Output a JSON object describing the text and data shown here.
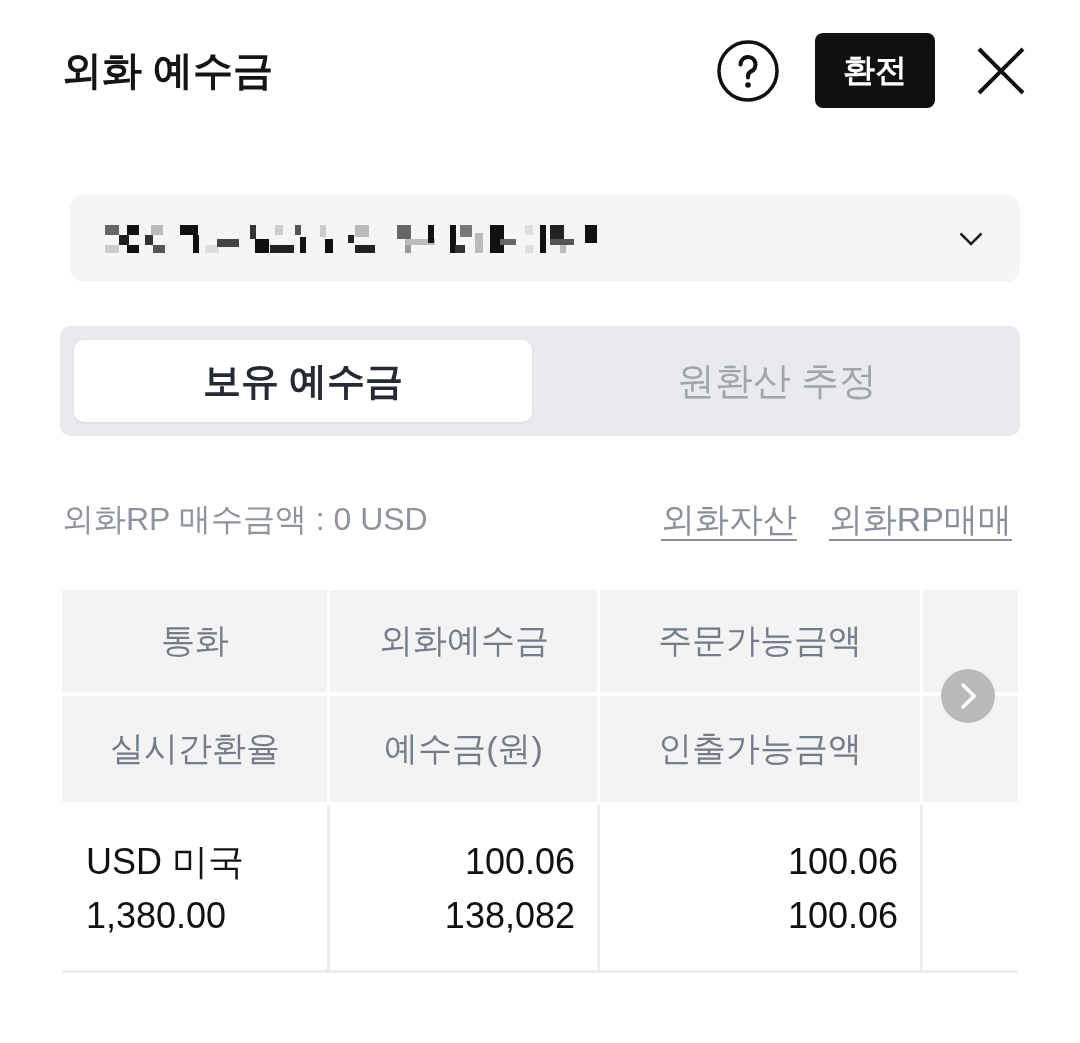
{
  "header": {
    "title": "외화 예수금",
    "exchange_button": "환전"
  },
  "account_select": {
    "masked": true
  },
  "tabs": [
    {
      "label": "보유 예수금",
      "selected": true
    },
    {
      "label": "원환산 추정",
      "selected": false
    }
  ],
  "rp_summary": "외화RP 매수금액 : 0 USD",
  "links": [
    "외화자산",
    "외화RP매매"
  ],
  "table": {
    "header_rows": [
      [
        "통화",
        "외화예수금",
        "주문가능금액"
      ],
      [
        "실시간환율",
        "예수금(원)",
        "인출가능금액"
      ]
    ],
    "rows": [
      [
        [
          "USD 미국",
          "1,380.00"
        ],
        [
          "100.06",
          "138,082"
        ],
        [
          "100.06",
          "100.06"
        ]
      ]
    ],
    "more_columns": true
  }
}
